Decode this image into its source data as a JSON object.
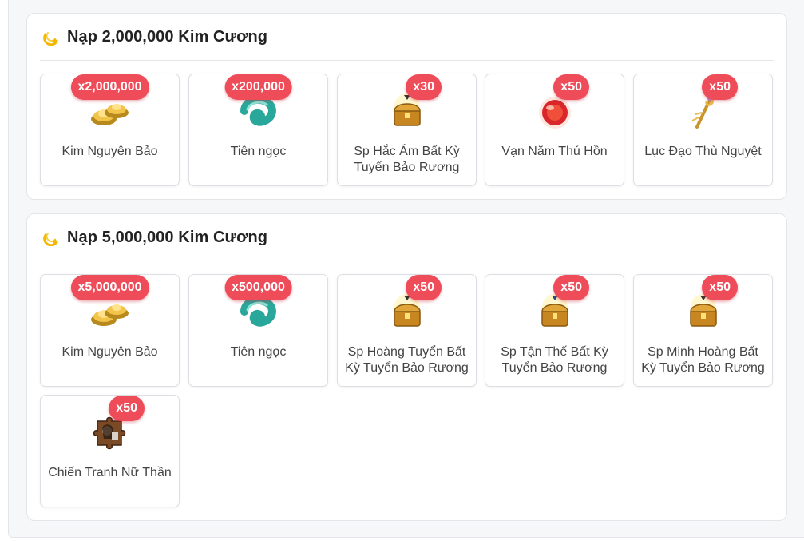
{
  "sections": [
    {
      "title": "Nạp 2,000,000 Kim Cương",
      "items": [
        {
          "badge": "x2,000,000",
          "name": "Kim Nguyên Bảo",
          "icon": "gold-ingot-icon"
        },
        {
          "badge": "x200,000",
          "name": "Tiên ngọc",
          "icon": "jade-icon"
        },
        {
          "badge": "x30",
          "name": "Sp Hắc Ám Bất Kỳ Tuyển Bảo Rương",
          "icon": "treasure-chest-icon"
        },
        {
          "badge": "x50",
          "name": "Vạn Năm Thú Hồn",
          "icon": "red-orb-icon"
        },
        {
          "badge": "x50",
          "name": "Lục Đạo Thù Nguyệt",
          "icon": "golden-staff-icon"
        }
      ]
    },
    {
      "title": "Nạp 5,000,000 Kim Cương",
      "items": [
        {
          "badge": "x5,000,000",
          "name": "Kim Nguyên Bảo",
          "icon": "gold-ingot-icon"
        },
        {
          "badge": "x500,000",
          "name": "Tiên ngọc",
          "icon": "jade-icon"
        },
        {
          "badge": "x50",
          "name": "Sp Hoàng Tuyển Bất Kỳ Tuyển Bảo Rương",
          "icon": "treasure-chest-icon"
        },
        {
          "badge": "x50",
          "name": "Sp Tận Thế Bất Kỳ Tuyển Bảo Rương",
          "icon": "treasure-chest-icon"
        },
        {
          "badge": "x50",
          "name": "Sp Minh Hoàng Bất Kỳ Tuyển Bảo Rương",
          "icon": "treasure-chest-icon"
        },
        {
          "badge": "x50",
          "name": "Chiến Tranh Nữ Thần",
          "icon": "puzzle-piece-icon"
        }
      ]
    }
  ],
  "colors": {
    "badge": "#ef4c5a",
    "section_bg": "#ffffff",
    "page_bg": "#f6f7f9",
    "title_icon": "#f2b705"
  }
}
